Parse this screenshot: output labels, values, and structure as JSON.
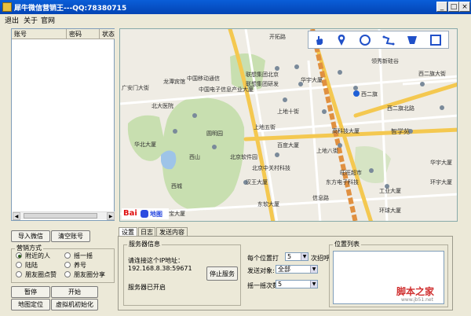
{
  "window": {
    "title": "犀牛微信营销王---QQ:78380715",
    "min_label": "_",
    "max_label": "□",
    "close_label": "×"
  },
  "menu": {
    "items": [
      "退出",
      "关于",
      "官网"
    ]
  },
  "accounts_table": {
    "columns": [
      "账号",
      "密码",
      "状态"
    ]
  },
  "left_buttons": {
    "import": "导入微信",
    "clear": "清空账号"
  },
  "marketing": {
    "legend": "营销方式",
    "options": [
      "附近的人",
      "摇一摇",
      "陆陆",
      "养号",
      "朋友圈点赞",
      "朋友圈分享"
    ]
  },
  "bottom_buttons": {
    "pause": "暂停",
    "start": "开始",
    "locate": "地图定位",
    "vm_init": "虚拟机初始化"
  },
  "map": {
    "logo": "Bai",
    "logo_cn": "地图",
    "labels": [
      "广安门大街",
      "华北大厦",
      "龙潭宾馆",
      "中国移动通信",
      "中国电子信息产业大厦",
      "北大医院",
      "联想集团北京",
      "联想集团研发",
      "华宇大厦",
      "领秀新硅谷",
      "西二旗",
      "西二旗北路",
      "西二旗大街",
      "智学苑",
      "上地十街",
      "上地五街",
      "上地八街",
      "北京软件园",
      "汉王大厦",
      "百度大厦",
      "旺旺超市",
      "东软大厦",
      "东方电子科技",
      "工业大厦",
      "华宇大厦",
      "环球大厦",
      "环宇大厦",
      "西山",
      "西城",
      "圆明园",
      "高科技大厦",
      "北京中关村科技",
      "信息路",
      "开拓路",
      "发宝大厦"
    ],
    "tools": [
      "hand-icon",
      "marker-icon",
      "circle-icon",
      "polyline-icon",
      "polygon-icon",
      "rectangle-icon"
    ]
  },
  "tabs": [
    "设置",
    "日志",
    "发送内容"
  ],
  "server": {
    "legend": "服务器信息",
    "connect_label": "请连接这个IP地址：",
    "ip": "192.168.8.38:59671",
    "status": "服务器已开启",
    "stop_button": "停止服务"
  },
  "settings": {
    "per_location_label": "每个位置打",
    "per_location_value": "5",
    "per_location_unit": "次招呼",
    "send_target_label": "发送对象:",
    "send_target_value": "全部",
    "shake_label": "摇一摇次数:",
    "shake_value": "5"
  },
  "locations": {
    "legend": "位置列表"
  },
  "watermark": {
    "text": "脚本之家",
    "url": "www.jb51.net"
  },
  "colors": {
    "title_bar": "#0a5ed8",
    "window_bg": "#ece9d8",
    "map_bg": "#efece4",
    "road_major": "#f4c850",
    "park": "#c8dfb0",
    "water": "#9ec4e8",
    "logo_blue": "#2d4ce0",
    "logo_red": "#e01010"
  }
}
